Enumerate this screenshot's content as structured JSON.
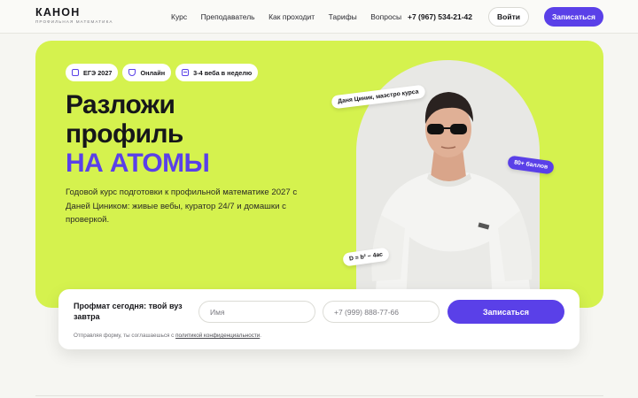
{
  "header": {
    "logo_name": "КАНОН",
    "logo_sub": "ПРОФИЛЬНАЯ МАТЕМАТИКА",
    "nav": [
      "Курс",
      "Преподаватель",
      "Как проходит",
      "Тарифы",
      "Вопросы"
    ],
    "phone": "+7 (967) 534-21-42",
    "login_label": "Войти",
    "signup_label": "Записаться"
  },
  "hero": {
    "tags": [
      {
        "label": "ЕГЭ 2027",
        "icon": "graduation-icon"
      },
      {
        "label": "Онлайн",
        "icon": "shield-icon"
      },
      {
        "label": "3-4 веба в неделю",
        "icon": "calendar-icon"
      }
    ],
    "title_line1": "Разложи",
    "title_line2": "профиль",
    "title_accent": "НА АТОМЫ",
    "description": "Годовой курс подготовки к профильной математике 2027 с Даней Циником: живые вебы, куратор 24/7 и домашки с проверкой.",
    "sticker_name": "Даня Циник, маэстро курса",
    "sticker_points": "80+ баллов",
    "sticker_formula": "D = b² − 4ac"
  },
  "form": {
    "title": "Профмат сегодня: твой вуз завтра",
    "name_placeholder": "Имя",
    "phone_placeholder": "+7 (999) 888-77-66",
    "submit_label": "Записаться",
    "consent_text": "Отправляя форму, ты соглашаешься с ",
    "consent_link": "политикой конфиденциальности",
    "consent_end": "."
  },
  "colors": {
    "accent": "#5a40e8",
    "hero_bg": "#d5f24e",
    "page_bg": "#f6f6f2"
  }
}
